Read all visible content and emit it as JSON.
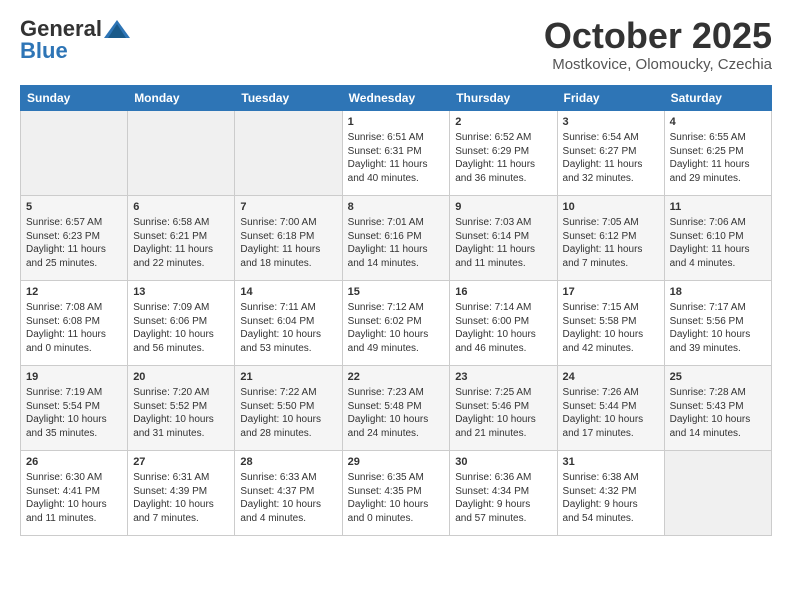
{
  "logo": {
    "general": "General",
    "blue": "Blue"
  },
  "header": {
    "title": "October 2025",
    "location": "Mostkovice, Olomoucky, Czechia"
  },
  "weekdays": [
    "Sunday",
    "Monday",
    "Tuesday",
    "Wednesday",
    "Thursday",
    "Friday",
    "Saturday"
  ],
  "weeks": [
    [
      {
        "day": "",
        "info": ""
      },
      {
        "day": "",
        "info": ""
      },
      {
        "day": "",
        "info": ""
      },
      {
        "day": "1",
        "info": "Sunrise: 6:51 AM\nSunset: 6:31 PM\nDaylight: 11 hours\nand 40 minutes."
      },
      {
        "day": "2",
        "info": "Sunrise: 6:52 AM\nSunset: 6:29 PM\nDaylight: 11 hours\nand 36 minutes."
      },
      {
        "day": "3",
        "info": "Sunrise: 6:54 AM\nSunset: 6:27 PM\nDaylight: 11 hours\nand 32 minutes."
      },
      {
        "day": "4",
        "info": "Sunrise: 6:55 AM\nSunset: 6:25 PM\nDaylight: 11 hours\nand 29 minutes."
      }
    ],
    [
      {
        "day": "5",
        "info": "Sunrise: 6:57 AM\nSunset: 6:23 PM\nDaylight: 11 hours\nand 25 minutes."
      },
      {
        "day": "6",
        "info": "Sunrise: 6:58 AM\nSunset: 6:21 PM\nDaylight: 11 hours\nand 22 minutes."
      },
      {
        "day": "7",
        "info": "Sunrise: 7:00 AM\nSunset: 6:18 PM\nDaylight: 11 hours\nand 18 minutes."
      },
      {
        "day": "8",
        "info": "Sunrise: 7:01 AM\nSunset: 6:16 PM\nDaylight: 11 hours\nand 14 minutes."
      },
      {
        "day": "9",
        "info": "Sunrise: 7:03 AM\nSunset: 6:14 PM\nDaylight: 11 hours\nand 11 minutes."
      },
      {
        "day": "10",
        "info": "Sunrise: 7:05 AM\nSunset: 6:12 PM\nDaylight: 11 hours\nand 7 minutes."
      },
      {
        "day": "11",
        "info": "Sunrise: 7:06 AM\nSunset: 6:10 PM\nDaylight: 11 hours\nand 4 minutes."
      }
    ],
    [
      {
        "day": "12",
        "info": "Sunrise: 7:08 AM\nSunset: 6:08 PM\nDaylight: 11 hours\nand 0 minutes."
      },
      {
        "day": "13",
        "info": "Sunrise: 7:09 AM\nSunset: 6:06 PM\nDaylight: 10 hours\nand 56 minutes."
      },
      {
        "day": "14",
        "info": "Sunrise: 7:11 AM\nSunset: 6:04 PM\nDaylight: 10 hours\nand 53 minutes."
      },
      {
        "day": "15",
        "info": "Sunrise: 7:12 AM\nSunset: 6:02 PM\nDaylight: 10 hours\nand 49 minutes."
      },
      {
        "day": "16",
        "info": "Sunrise: 7:14 AM\nSunset: 6:00 PM\nDaylight: 10 hours\nand 46 minutes."
      },
      {
        "day": "17",
        "info": "Sunrise: 7:15 AM\nSunset: 5:58 PM\nDaylight: 10 hours\nand 42 minutes."
      },
      {
        "day": "18",
        "info": "Sunrise: 7:17 AM\nSunset: 5:56 PM\nDaylight: 10 hours\nand 39 minutes."
      }
    ],
    [
      {
        "day": "19",
        "info": "Sunrise: 7:19 AM\nSunset: 5:54 PM\nDaylight: 10 hours\nand 35 minutes."
      },
      {
        "day": "20",
        "info": "Sunrise: 7:20 AM\nSunset: 5:52 PM\nDaylight: 10 hours\nand 31 minutes."
      },
      {
        "day": "21",
        "info": "Sunrise: 7:22 AM\nSunset: 5:50 PM\nDaylight: 10 hours\nand 28 minutes."
      },
      {
        "day": "22",
        "info": "Sunrise: 7:23 AM\nSunset: 5:48 PM\nDaylight: 10 hours\nand 24 minutes."
      },
      {
        "day": "23",
        "info": "Sunrise: 7:25 AM\nSunset: 5:46 PM\nDaylight: 10 hours\nand 21 minutes."
      },
      {
        "day": "24",
        "info": "Sunrise: 7:26 AM\nSunset: 5:44 PM\nDaylight: 10 hours\nand 17 minutes."
      },
      {
        "day": "25",
        "info": "Sunrise: 7:28 AM\nSunset: 5:43 PM\nDaylight: 10 hours\nand 14 minutes."
      }
    ],
    [
      {
        "day": "26",
        "info": "Sunrise: 6:30 AM\nSunset: 4:41 PM\nDaylight: 10 hours\nand 11 minutes."
      },
      {
        "day": "27",
        "info": "Sunrise: 6:31 AM\nSunset: 4:39 PM\nDaylight: 10 hours\nand 7 minutes."
      },
      {
        "day": "28",
        "info": "Sunrise: 6:33 AM\nSunset: 4:37 PM\nDaylight: 10 hours\nand 4 minutes."
      },
      {
        "day": "29",
        "info": "Sunrise: 6:35 AM\nSunset: 4:35 PM\nDaylight: 10 hours\nand 0 minutes."
      },
      {
        "day": "30",
        "info": "Sunrise: 6:36 AM\nSunset: 4:34 PM\nDaylight: 9 hours\nand 57 minutes."
      },
      {
        "day": "31",
        "info": "Sunrise: 6:38 AM\nSunset: 4:32 PM\nDaylight: 9 hours\nand 54 minutes."
      },
      {
        "day": "",
        "info": ""
      }
    ]
  ]
}
